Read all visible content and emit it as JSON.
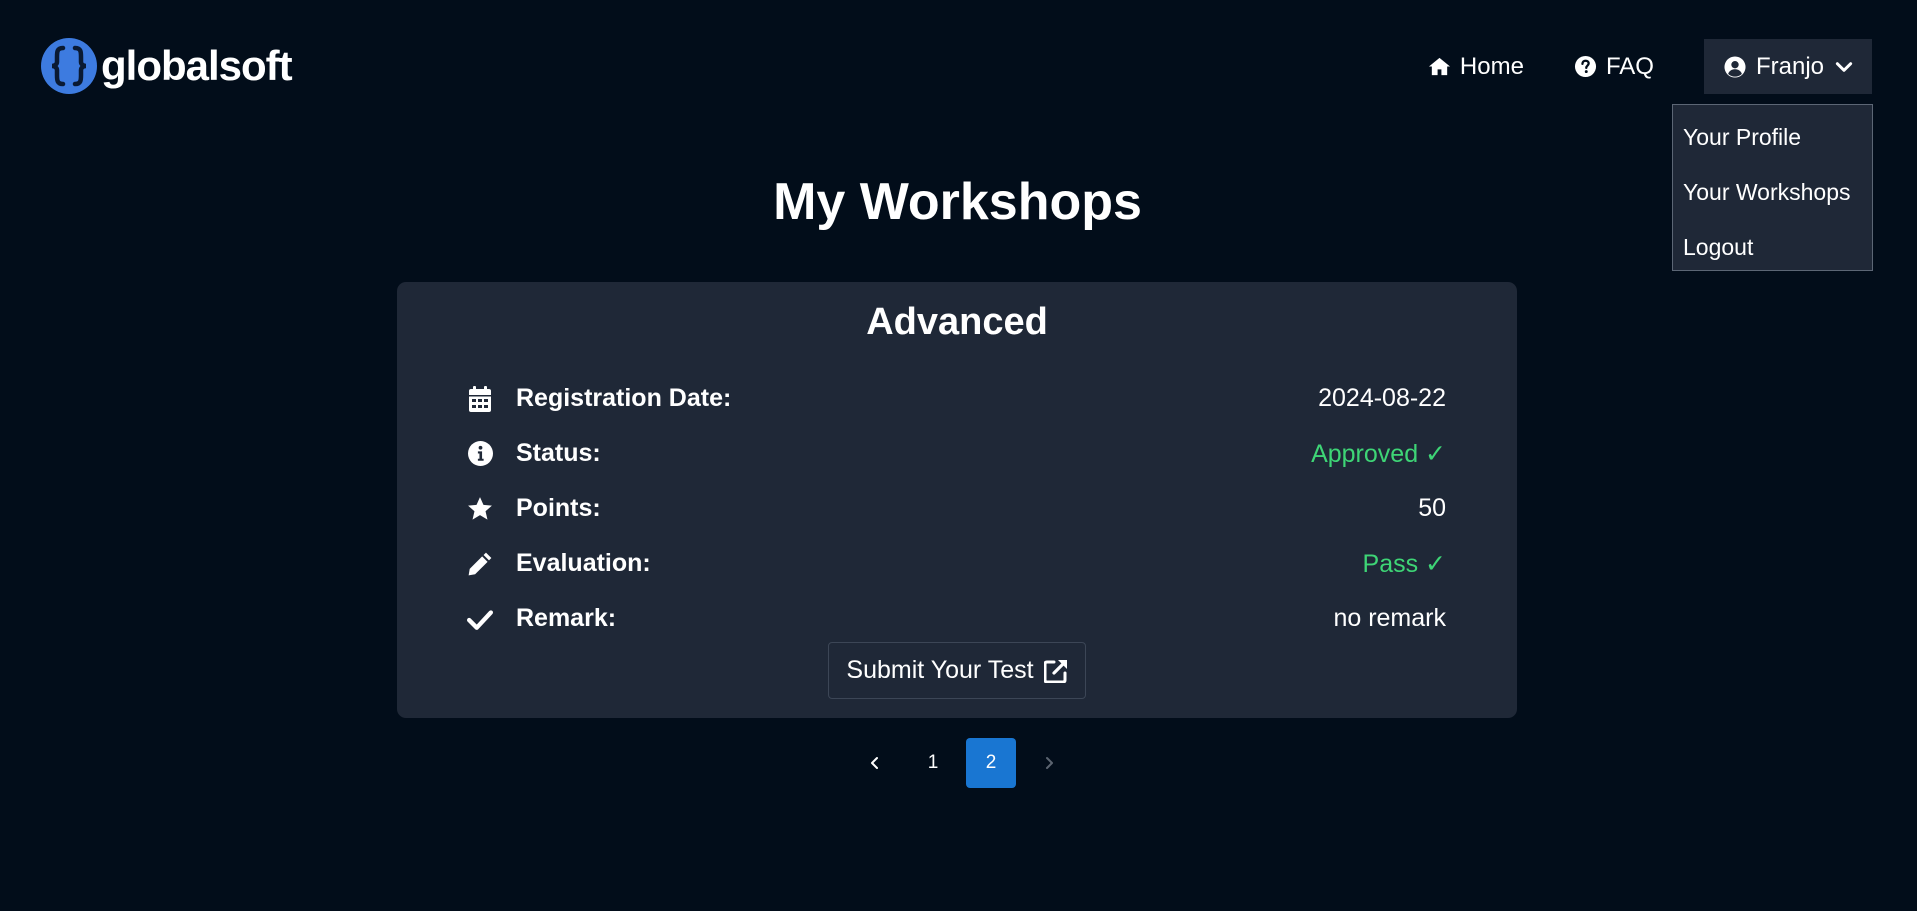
{
  "brand": {
    "name": "globalsoft",
    "logo_icon": "curly-braces-logo"
  },
  "nav": {
    "home_label": "Home",
    "faq_label": "FAQ",
    "user_name": "Franjo"
  },
  "user_menu": {
    "items": [
      "Your Profile",
      "Your Workshops",
      "Logout"
    ]
  },
  "page": {
    "title": "My Workshops"
  },
  "workshop": {
    "title": "Advanced",
    "rows": [
      {
        "icon": "calendar-icon",
        "label": "Registration Date:",
        "value": "2024-08-22"
      },
      {
        "icon": "info-icon",
        "label": "Status:",
        "value": "Approved ✓"
      },
      {
        "icon": "star-icon",
        "label": "Points:",
        "value": "50"
      },
      {
        "icon": "pencil-icon",
        "label": "Evaluation:",
        "value": "Pass ✓"
      },
      {
        "icon": "check-icon",
        "label": "Remark:",
        "value": "no remark"
      }
    ],
    "submit_label": "Submit Your Test"
  },
  "pagination": {
    "pages": [
      "1",
      "2"
    ],
    "current": "2"
  },
  "colors": {
    "background": "#020d1a",
    "card": "#1f2837",
    "accent": "#1976d2",
    "success": "#3ed576",
    "logo": "#3d7be0"
  }
}
